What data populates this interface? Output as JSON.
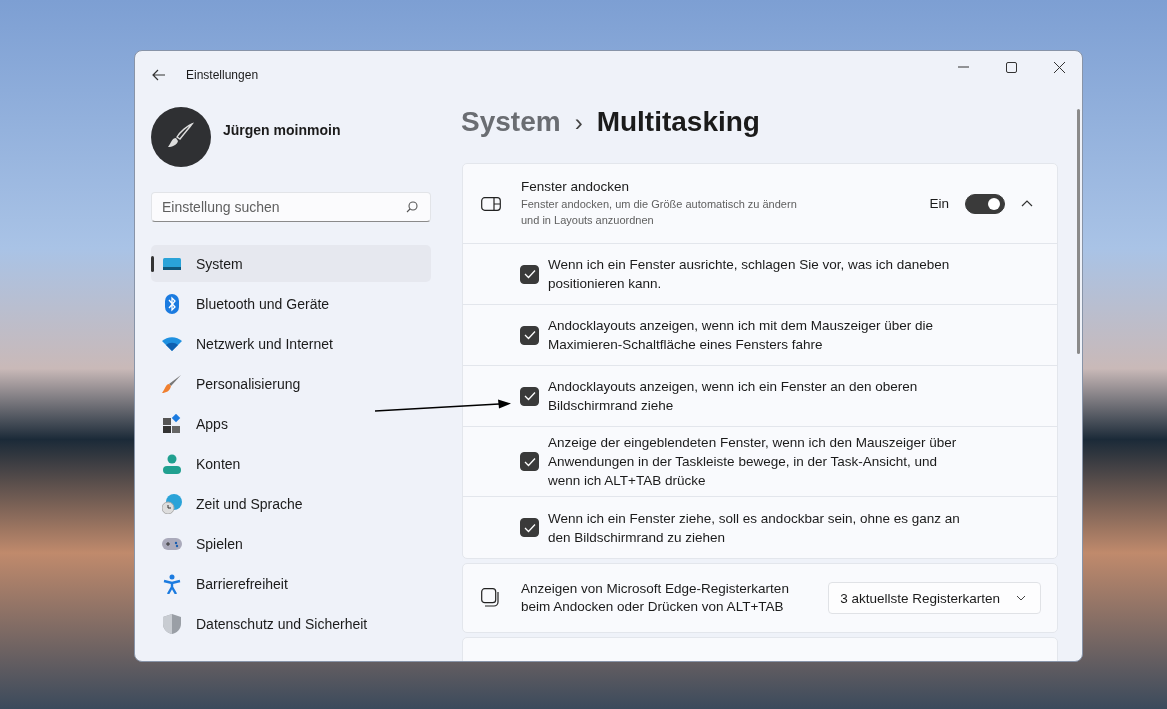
{
  "window": {
    "title": "Einstellungen"
  },
  "user": {
    "name": "Jürgen moinmoin"
  },
  "search": {
    "placeholder": "Einstellung suchen"
  },
  "nav": [
    {
      "label": "System",
      "selected": true
    },
    {
      "label": "Bluetooth und Geräte",
      "selected": false
    },
    {
      "label": "Netzwerk und Internet",
      "selected": false
    },
    {
      "label": "Personalisierung",
      "selected": false
    },
    {
      "label": "Apps",
      "selected": false
    },
    {
      "label": "Konten",
      "selected": false
    },
    {
      "label": "Zeit und Sprache",
      "selected": false
    },
    {
      "label": "Spielen",
      "selected": false
    },
    {
      "label": "Barrierefreiheit",
      "selected": false
    },
    {
      "label": "Datenschutz und Sicherheit",
      "selected": false
    }
  ],
  "breadcrumb": {
    "parent": "System",
    "separator": "›",
    "current": "Multitasking"
  },
  "snap": {
    "title": "Fenster andocken",
    "description": "Fenster andocken, um die Größe automatisch zu ändern und in Layouts anzuordnen",
    "toggle_label": "Ein",
    "on": true,
    "expanded": true,
    "options": [
      {
        "label": "Wenn ich ein Fenster ausrichte, schlagen Sie vor, was ich daneben positionieren kann.",
        "checked": true
      },
      {
        "label": "Andocklayouts anzeigen, wenn ich mit dem Mauszeiger über die Maximieren-Schaltfläche eines Fensters fahre",
        "checked": true
      },
      {
        "label": "Andocklayouts anzeigen, wenn ich ein Fenster an den oberen Bildschirmrand ziehe",
        "checked": true
      },
      {
        "label": "Anzeige der eingeblendeten Fenster, wenn ich den Mauszeiger über Anwendungen in der Taskleiste bewege, in der Task-Ansicht, und wenn ich ALT+TAB drücke",
        "checked": true
      },
      {
        "label": "Wenn ich ein Fenster ziehe, soll es andockbar sein, ohne es ganz an den Bildschirmrand zu ziehen",
        "checked": true
      }
    ]
  },
  "edge_tabs": {
    "label": "Anzeigen von Microsoft Edge-Registerkarten beim Andocken oder Drücken von ALT+TAB",
    "value": "3 aktuellste Registerkarten"
  }
}
